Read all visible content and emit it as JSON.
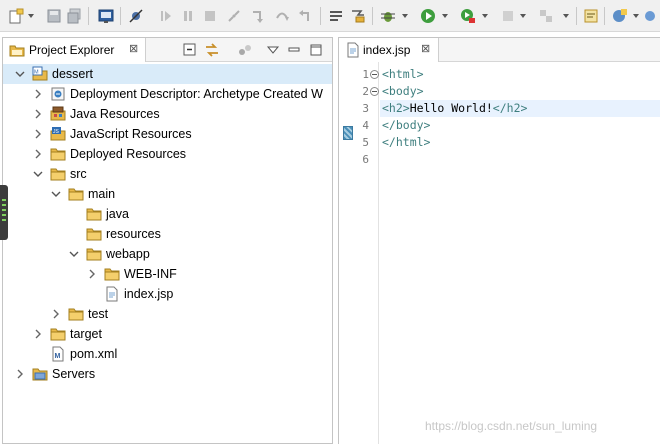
{
  "explorer": {
    "title": "Project Explorer",
    "close": "⊠",
    "tree": [
      {
        "label": "dessert",
        "icon": "maven-project-icon",
        "twisty": "open",
        "depth": 0,
        "selected": true
      },
      {
        "label": "Deployment Descriptor: Archetype Created W",
        "icon": "deployment-descriptor-icon",
        "twisty": "closed",
        "depth": 1
      },
      {
        "label": "Java Resources",
        "icon": "java-resources-icon",
        "twisty": "closed",
        "depth": 1
      },
      {
        "label": "JavaScript Resources",
        "icon": "javascript-resources-icon",
        "twisty": "closed",
        "depth": 1
      },
      {
        "label": "Deployed Resources",
        "icon": "folder-icon",
        "twisty": "closed",
        "depth": 1
      },
      {
        "label": "src",
        "icon": "folder-icon",
        "twisty": "open",
        "depth": 1
      },
      {
        "label": "main",
        "icon": "folder-icon",
        "twisty": "open",
        "depth": 2
      },
      {
        "label": "java",
        "icon": "folder-icon",
        "twisty": "none",
        "depth": 3
      },
      {
        "label": "resources",
        "icon": "folder-icon",
        "twisty": "none",
        "depth": 3
      },
      {
        "label": "webapp",
        "icon": "folder-icon",
        "twisty": "open",
        "depth": 3
      },
      {
        "label": "WEB-INF",
        "icon": "folder-icon",
        "twisty": "closed",
        "depth": 4
      },
      {
        "label": "index.jsp",
        "icon": "jsp-file-icon",
        "twisty": "none",
        "depth": 4
      },
      {
        "label": "test",
        "icon": "folder-icon",
        "twisty": "closed",
        "depth": 2
      },
      {
        "label": "target",
        "icon": "folder-icon",
        "twisty": "closed",
        "depth": 1
      },
      {
        "label": "pom.xml",
        "icon": "maven-pom-icon",
        "twisty": "none",
        "depth": 1
      },
      {
        "label": "Servers",
        "icon": "servers-folder-icon",
        "twisty": "closed",
        "depth": 0
      }
    ]
  },
  "editor": {
    "tab_title": "index.jsp",
    "close": "⊠",
    "lines": [
      {
        "num": "1",
        "fold": true,
        "code": "<html>"
      },
      {
        "num": "2",
        "fold": true,
        "code": "<body>"
      },
      {
        "num": "3",
        "fold": false,
        "code": "<h2>Hello World!</h2>",
        "current": true
      },
      {
        "num": "4",
        "fold": false,
        "code": "</body>"
      },
      {
        "num": "5",
        "fold": false,
        "code": "</html>"
      },
      {
        "num": "6",
        "fold": false,
        "code": ""
      }
    ]
  },
  "watermark": "https://blog.csdn.net/sun_luming",
  "colors": {
    "tag": "#3f7f7f",
    "selection": "#d9ebf9",
    "current_line": "#e8f2fe",
    "folder": "#e8b94a"
  }
}
